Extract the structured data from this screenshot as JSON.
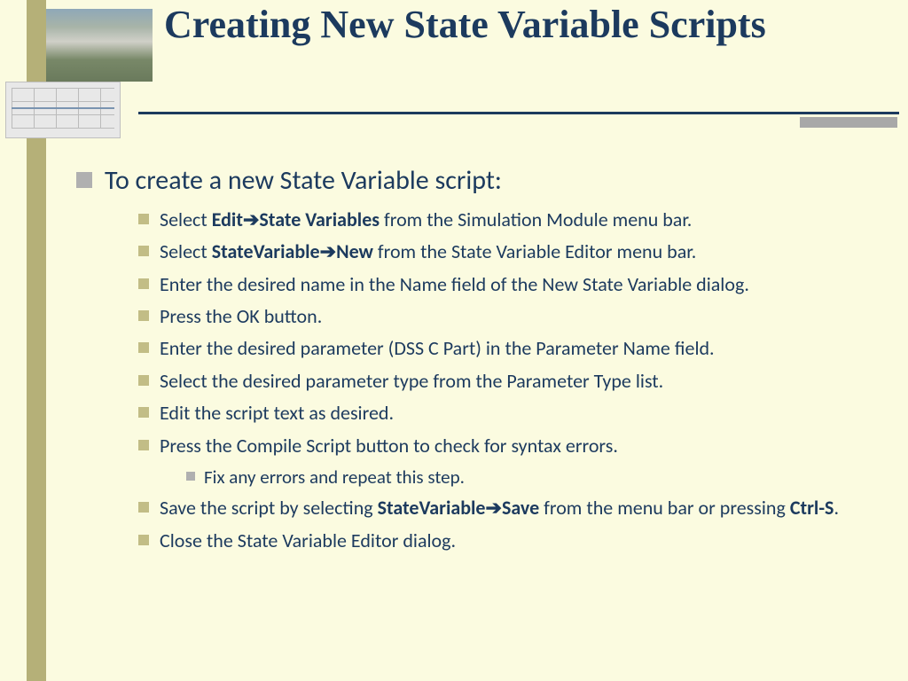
{
  "title": "Creating New State Variable Scripts",
  "intro": "To create a new State Variable script:",
  "arrow": "➔",
  "steps": [
    {
      "prefix": "Select ",
      "bold1": "Edit",
      "bold2": "State Variables",
      "suffix": " from the Simulation Module menu bar."
    },
    {
      "prefix": "Select ",
      "bold1": "StateVariable",
      "bold2": "New",
      "suffix": " from the State Variable Editor menu bar."
    },
    {
      "plain": "Enter the desired name in the Name field of the New State Variable dialog."
    },
    {
      "plain": "Press the OK button."
    },
    {
      "plain": "Enter the desired parameter (DSS C Part) in the Parameter Name field."
    },
    {
      "plain": "Select the desired parameter type from the Parameter Type list."
    },
    {
      "plain": "Edit the script text as desired."
    },
    {
      "plain": "Press the Compile Script button to check for syntax errors.",
      "sub": [
        "Fix any errors and repeat this step."
      ]
    },
    {
      "prefix": "Save the script by selecting ",
      "bold1": "StateVariable",
      "bold2": "Save",
      "suffix": " from the menu bar or pressing ",
      "bold3": "Ctrl-S",
      "tail": "."
    },
    {
      "plain": "Close the State Variable Editor dialog."
    }
  ]
}
